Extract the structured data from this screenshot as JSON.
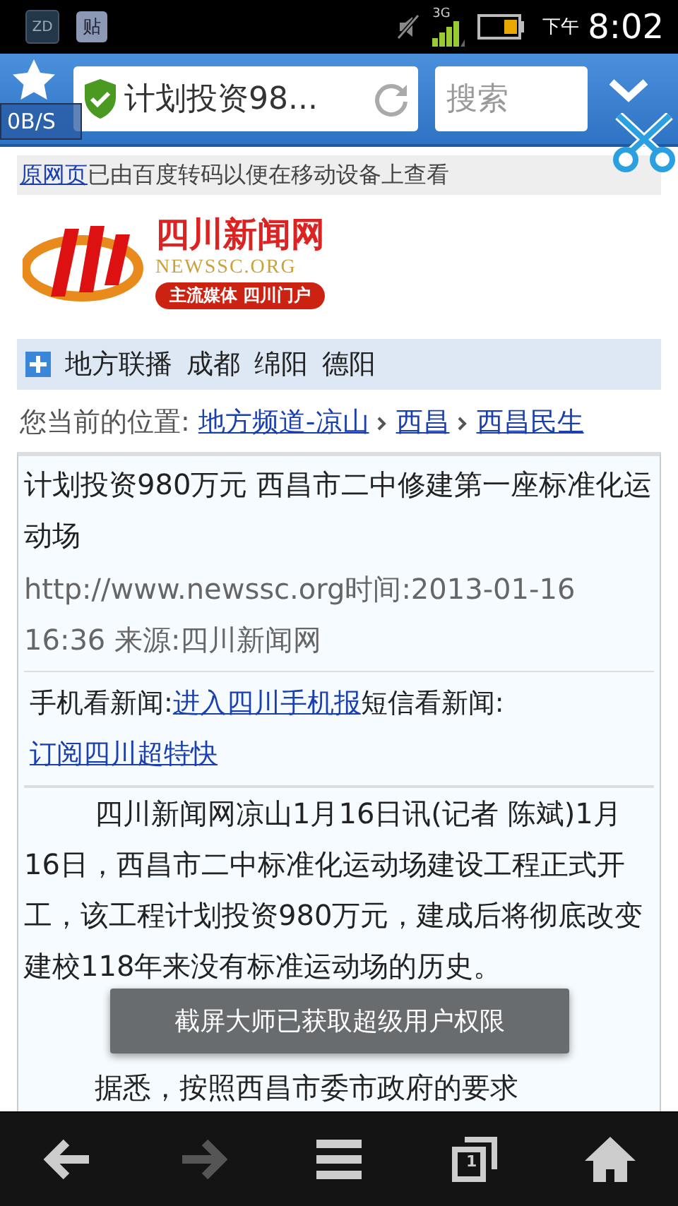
{
  "status_bar": {
    "notification_icons": [
      "ZD",
      "贴"
    ],
    "network": "3G",
    "period": "下午",
    "time": "8:02"
  },
  "browser_bar": {
    "page_title": "计划投资98...",
    "search_placeholder": "搜索",
    "traffic": "0B/S"
  },
  "transcode_notice": {
    "link": "原网页",
    "text": "已由百度转码以便在移动设备上查看"
  },
  "logo": {
    "name": "四川新闻网",
    "domain": "NEWSSC.ORG",
    "slogan": "主流媒体 四川门户"
  },
  "local_bar": {
    "items": [
      "地方联播",
      "成都",
      "绵阳",
      "德阳"
    ]
  },
  "breadcrumb": {
    "label": "您当前的位置:",
    "links": [
      "地方频道-凉山",
      "西昌",
      "西昌民生"
    ]
  },
  "article": {
    "title": "计划投资980万元 西昌市二中修建第一座标准化运动场",
    "meta": "http://www.newssc.org时间:2013-01-16 16:36 来源:四川新闻网",
    "mobile": [
      {
        "label": "手机看新闻:",
        "link": "进入四川手机报"
      },
      {
        "label": "短信看新闻:",
        "link": "订阅四川超特快"
      }
    ],
    "paragraphs": [
      "四川新闻网凉山1月16日讯(记者 陈斌)1月16日，西昌市二中标准化运动场建设工程正式开工，该工程计划投资980万元，建成后将彻底改变建校118年来没有标准运动场的历史。",
      "据悉，按照西昌市委市政府的要求"
    ]
  },
  "toast": "截屏大师已获取超级用户权限",
  "nav": [
    {
      "kind": "back",
      "disabled": false
    },
    {
      "kind": "forward",
      "disabled": true
    },
    {
      "kind": "menu",
      "disabled": false
    },
    {
      "kind": "tabs",
      "disabled": false,
      "count": "1"
    },
    {
      "kind": "home",
      "disabled": false
    }
  ]
}
